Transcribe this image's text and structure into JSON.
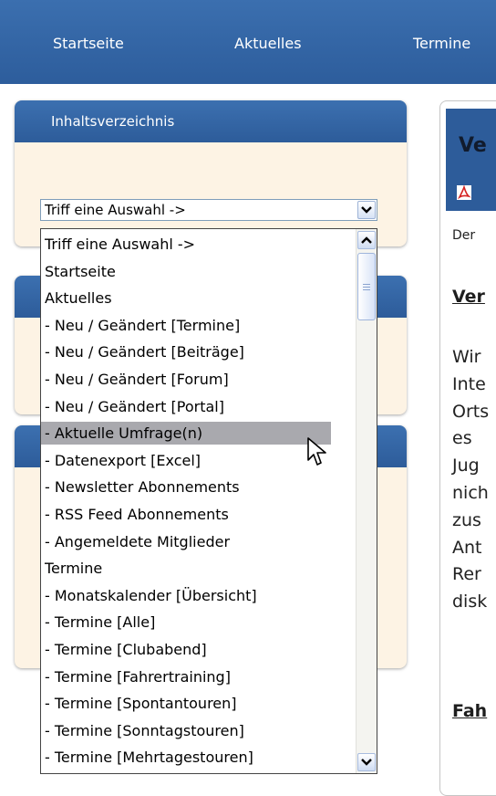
{
  "nav": {
    "items": [
      "Startseite",
      "Aktuelles",
      "Termine"
    ]
  },
  "sidebar": {
    "box1_title": "Inhaltsverzeichnis"
  },
  "select": {
    "value": "Triff eine Auswahl ->",
    "options": [
      "Triff eine Auswahl ->",
      "Startseite",
      "Aktuelles",
      " - Neu / Geändert [Termine]",
      " - Neu / Geändert [Beiträge]",
      " - Neu / Geändert [Forum]",
      " - Neu / Geändert [Portal]",
      " - Aktuelle Umfrage(n)",
      " - Datenexport [Excel]",
      " - Newsletter Abonnements",
      " - RSS Feed Abonnements",
      " - Angemeldete Mitglieder",
      "Termine",
      " - Monatskalender [Übersicht]",
      " - Termine [Alle]",
      " - Termine [Clubabend]",
      " - Termine [Fahrertraining]",
      " - Termine [Spontantouren]",
      " - Termine [Sonntagstouren]",
      " - Termine [Mehrtagestouren]"
    ],
    "highlighted_index": 7
  },
  "content": {
    "title": "Ve",
    "subtext": "Der",
    "heading": "Ver",
    "lines": [
      "Wir",
      "Inte",
      "Orts",
      "es",
      "Jug",
      "nich",
      "zus",
      "Ant",
      "Rer",
      "disk"
    ],
    "heading2": "Fah"
  },
  "colors": {
    "nav_bg": "#2d5d9c",
    "box_header": "#2d5c9a",
    "box_body": "#fdf3e4",
    "highlight": "#a9a9ae"
  }
}
